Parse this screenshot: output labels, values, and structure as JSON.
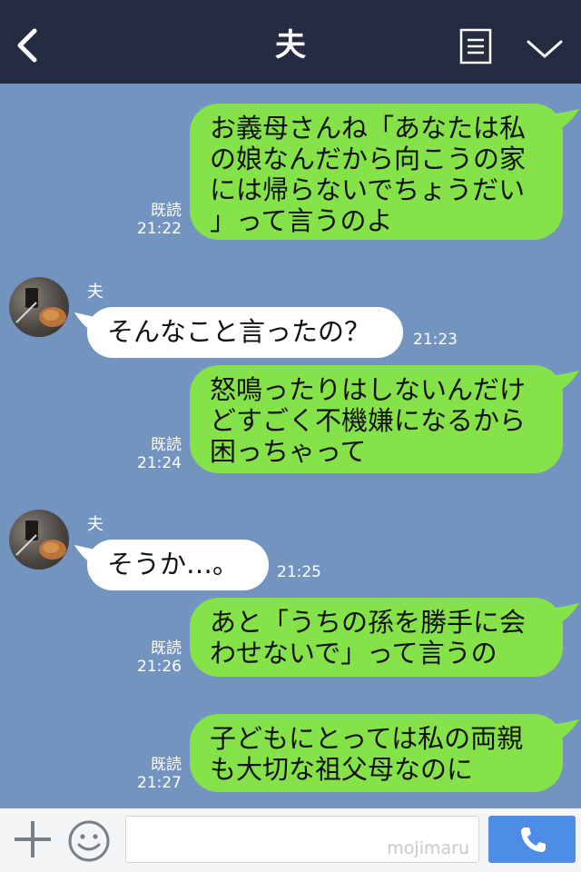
{
  "header": {
    "title": "夫",
    "back_icon": "chevron-left-icon",
    "menu_icon": "note-list-icon",
    "dropdown_icon": "chevron-down-icon"
  },
  "colors": {
    "header_bg": "#252c41",
    "chat_bg": "#7494c0",
    "outgoing_bubble": "#85e249",
    "incoming_bubble": "#ffffff",
    "send_button": "#4d8de8"
  },
  "messages": [
    {
      "direction": "out",
      "text": "お義母さんね「あなたは私\nの娘なんだから向こうの家\nには帰らないでちょうだい\n」って言うのよ",
      "read": "既読",
      "time": "21:22"
    },
    {
      "direction": "in",
      "sender": "夫",
      "text": "そんなこと言ったの？",
      "time": "21:23"
    },
    {
      "direction": "out",
      "text": "怒鳴ったりはしないんだけ\nどすごく不機嫌になるから\n困っちゃって",
      "read": "既読",
      "time": "21:24"
    },
    {
      "direction": "in",
      "sender": "夫",
      "text": "そうか…。",
      "time": "21:25"
    },
    {
      "direction": "out",
      "text": "あと「うちの孫を勝手に会\nわせないで」って言うの",
      "read": "既読",
      "time": "21:26"
    },
    {
      "direction": "out",
      "text": "子どもにとっては私の両親\nも大切な祖父母なのに",
      "read": "既読",
      "time": "21:27"
    }
  ],
  "footer": {
    "plus_icon": "plus-icon",
    "sticker_icon": "smiley-icon",
    "input_value": "",
    "watermark": "mojimaru",
    "send_icon": "phone-icon"
  }
}
